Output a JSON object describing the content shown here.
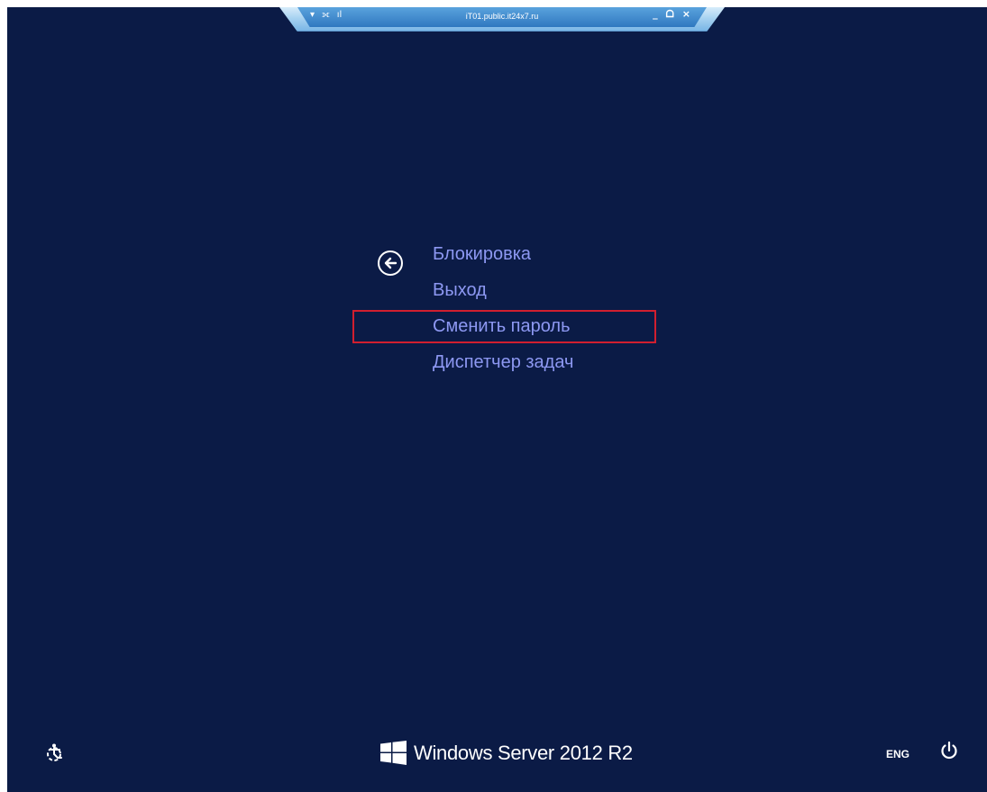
{
  "rdp_bar": {
    "title": "iT01.public.it24x7.ru",
    "pin_glyph": "▾",
    "signal_glyph": "⟗",
    "bars_glyph": "ıl",
    "minimize_glyph": "_",
    "restore_glyph": "ᗝ",
    "close_glyph": "×"
  },
  "menu": {
    "items": [
      {
        "label": "Блокировка"
      },
      {
        "label": "Выход"
      },
      {
        "label": "Сменить пароль"
      },
      {
        "label": "Диспетчер задач"
      }
    ]
  },
  "footer": {
    "brand": "Windows Server 2012 R2",
    "language": "ENG"
  },
  "icons": {
    "back": "back-arrow-icon",
    "ease_of_access": "ease-of-access-icon",
    "windows_logo": "windows-logo-icon",
    "power": "power-icon"
  },
  "colors": {
    "background": "#0b1b46",
    "menu_text": "#8d98f2",
    "highlight": "#d11f2f"
  }
}
